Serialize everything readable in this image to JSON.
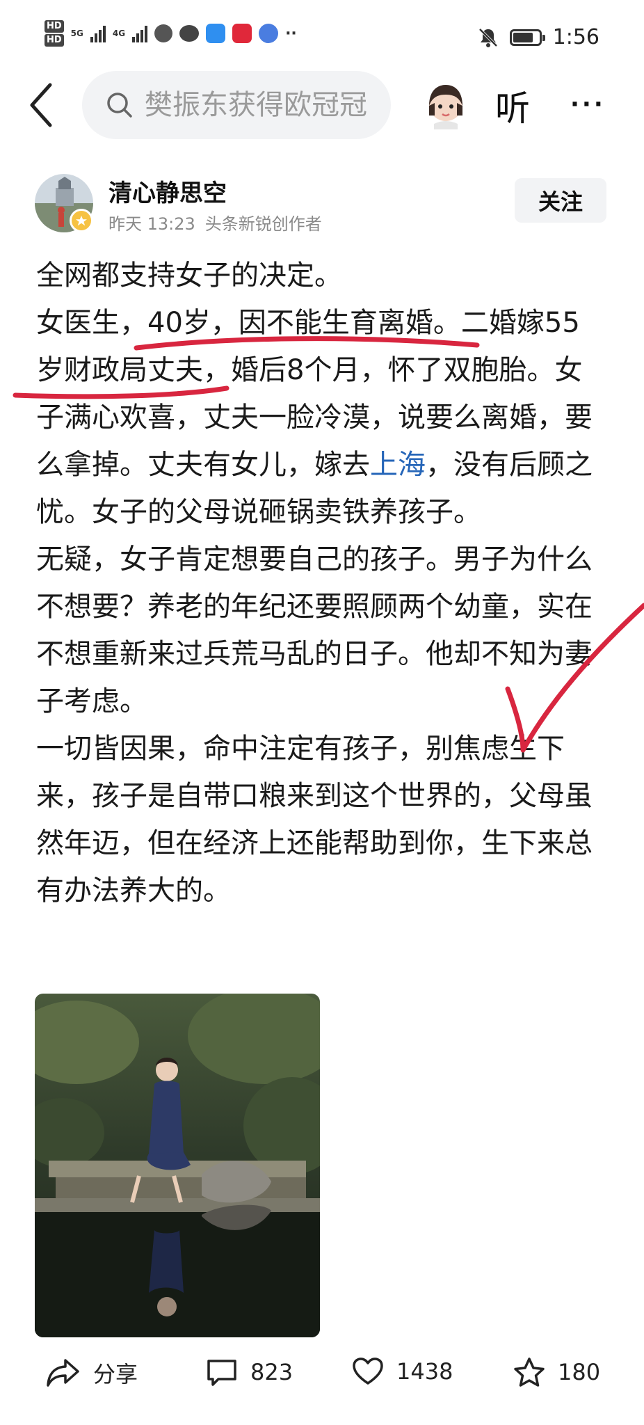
{
  "status_bar": {
    "network_1": "5G",
    "network_2": "4G",
    "time": "1:56",
    "icons": [
      "hd-icon",
      "signal-icon",
      "signal-icon",
      "app-icon",
      "wechat-icon",
      "cloud-icon",
      "red-app-icon",
      "blue-app-icon",
      "more-dots-icon",
      "mute-icon",
      "battery-icon"
    ]
  },
  "top_bar": {
    "search_placeholder": "樊振东获得欧冠冠",
    "listen_label": "听",
    "more_label": "···"
  },
  "author": {
    "name": "清心静思空",
    "time": "昨天  13:23",
    "tag": "头条新锐创作者",
    "follow_label": "关注"
  },
  "article": {
    "p1": "全网都支持女子的决定。",
    "p2": "女医生，40岁，因不能生育离婚。二婚嫁55岁财政局丈夫，婚后8个月，怀了双胞胎。女子满心欢喜，丈夫一脸冷漠，说要么离婚，要么拿掉。丈夫有女儿，嫁去",
    "p2_link": "上海",
    "p2_tail": "，没有后顾之忧。女子的父母说砸锅卖铁养孩子。",
    "p3": "无疑，女子肯定想要自己的孩子。男子为什么不想要？养老的年纪还要照顾两个幼童，实在不想重新来过兵荒马乱的日子。他却不知为妻子考虑。",
    "p4": "一切皆因果，命中注定有孩子，别焦虑生下来，孩子是自带口粮来到这个世界的，父母虽然年迈，但在经济上还能帮助到你，生下来总有办法养大的。"
  },
  "actions": {
    "share_label": "分享",
    "comments": "823",
    "likes": "1438",
    "favorites": "180"
  },
  "colors": {
    "link": "#2565b8",
    "annotation": "#d8263f",
    "search_bg": "#f2f3f5"
  },
  "battery_level": 0.8
}
